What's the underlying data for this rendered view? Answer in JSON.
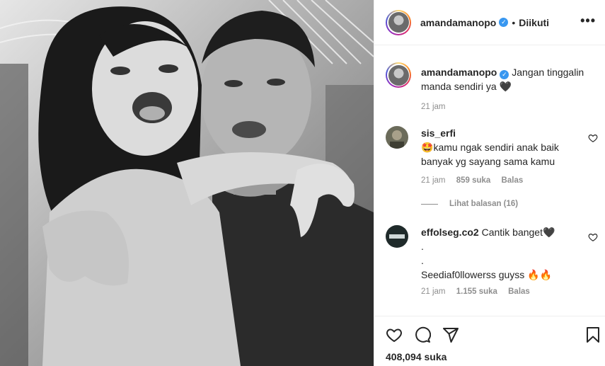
{
  "post": {
    "author": "amandamanopo",
    "verified": true,
    "separator": "•",
    "follow_status": "Diikuti",
    "more_label": "•••"
  },
  "caption": {
    "username": "amandamanopo",
    "text": "Jangan tinggalin manda sendiri ya",
    "heart_emoji": "🖤",
    "time": "21 jam"
  },
  "comments": [
    {
      "username": "sis_erfi",
      "emoji": "🤩",
      "text": "kamu ngak sendiri anak baik banyak yg sayang sama kamu",
      "time": "21 jam",
      "likes": "859 suka",
      "reply_label": "Balas"
    },
    {
      "username": "effolseg.co2",
      "text": "Cantik banget",
      "heart_emoji": "🖤",
      "line2": ".",
      "line3": ".",
      "line4": "Seediaf0llowerss guyss",
      "fire_emoji": "🔥🔥",
      "time": "21 jam",
      "likes": "1.155 suka",
      "reply_label": "Balas"
    }
  ],
  "view_replies": "Lihat balasan (16)",
  "actions": {
    "like_icon": "heart-icon",
    "comment_icon": "comment-icon",
    "share_icon": "share-icon",
    "save_icon": "bookmark-icon"
  },
  "likes_count": "408,094 suka",
  "colors": {
    "text": "#262626",
    "muted": "#8e8e8e",
    "verified": "#3897f0",
    "border": "#efefef"
  }
}
